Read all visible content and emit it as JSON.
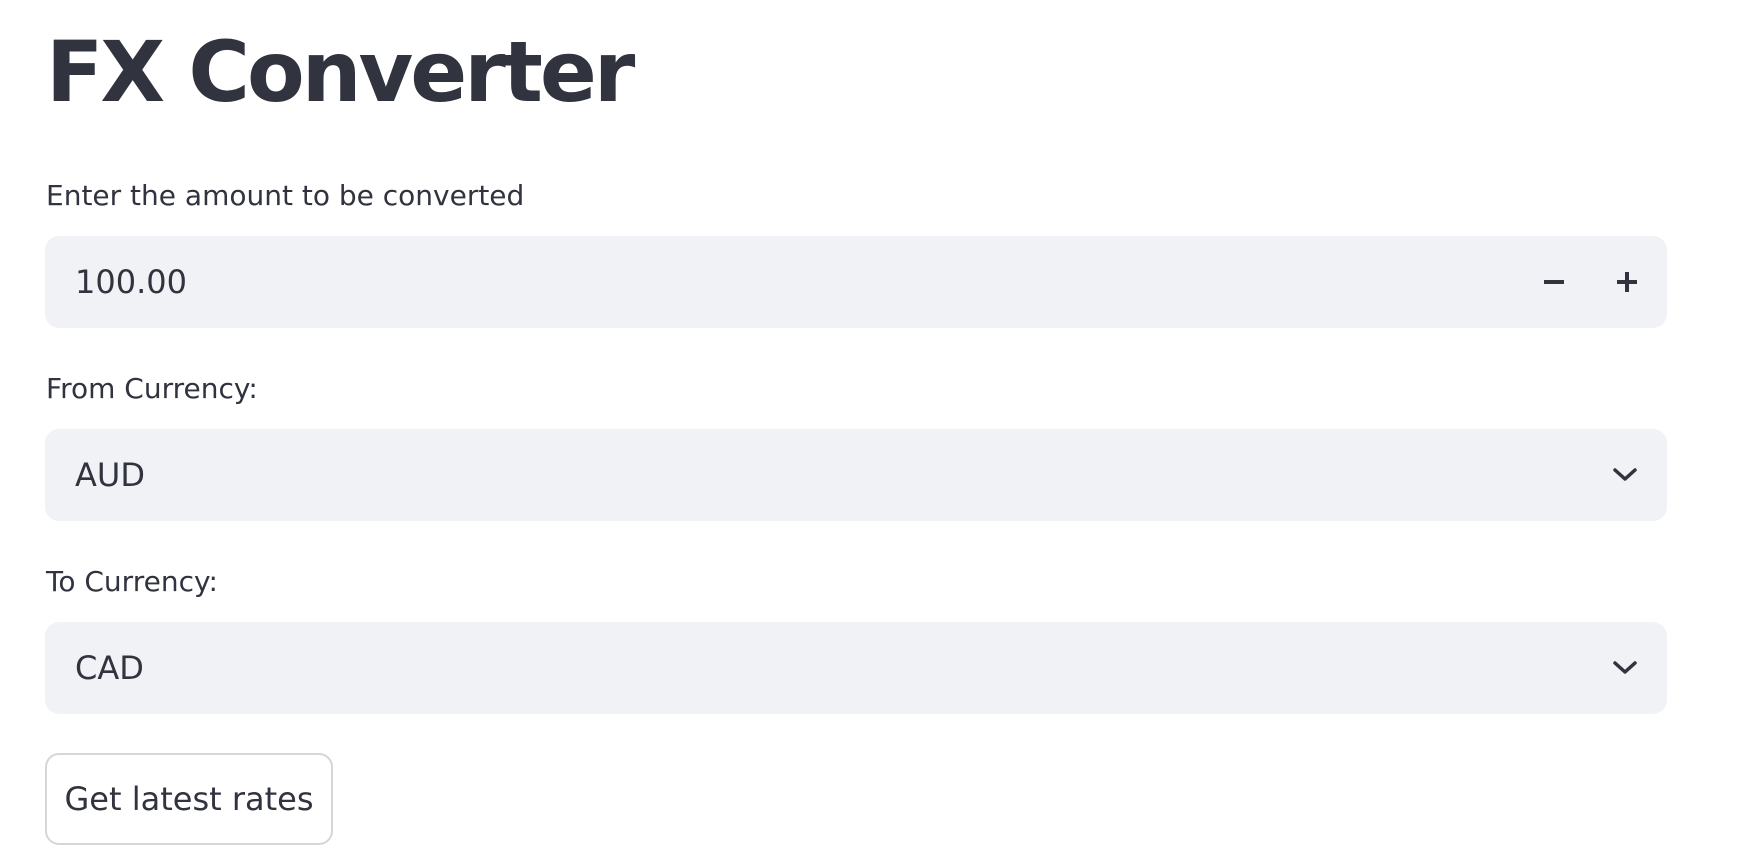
{
  "app": {
    "title": "FX Converter"
  },
  "amount": {
    "label": "Enter the amount to be converted",
    "value": "100.00",
    "decrement_icon": "minus-icon",
    "increment_icon": "plus-icon"
  },
  "from_currency": {
    "label": "From Currency:",
    "selected": "AUD",
    "icon": "chevron-down-icon"
  },
  "to_currency": {
    "label": "To Currency:",
    "selected": "CAD",
    "icon": "chevron-down-icon"
  },
  "actions": {
    "get_rates_label": "Get latest rates"
  },
  "colors": {
    "text": "#31333f",
    "input_background": "#f0f2f6",
    "button_border": "#d6d6d9",
    "background": "#ffffff"
  }
}
